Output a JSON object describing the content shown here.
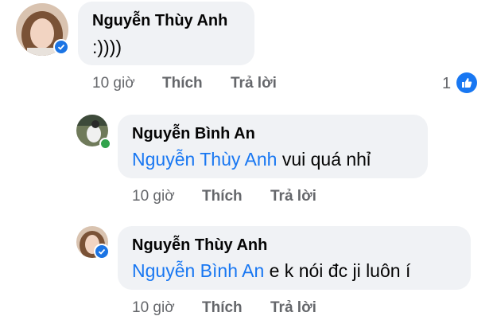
{
  "comments": [
    {
      "author": "Nguyễn Thùy Anh",
      "mention": "",
      "text": ":))))",
      "time": "10 giờ",
      "like_label": "Thích",
      "reply_label": "Trả lời",
      "reaction_count": "1",
      "reaction_icon": "thumbs-up-icon",
      "verified": true
    },
    {
      "author": "Nguyễn Bình An",
      "mention": "Nguyễn Thùy Anh",
      "text": " vui quá nhỉ",
      "time": "10 giờ",
      "like_label": "Thích",
      "reply_label": "Trả lời",
      "online": true
    },
    {
      "author": "Nguyễn Thùy Anh",
      "mention": "Nguyễn Bình An",
      "text": " e k nói đc ji luôn í",
      "time": "10 giờ",
      "like_label": "Thích",
      "reply_label": "Trả lời",
      "verified": true
    }
  ],
  "colors": {
    "mention": "#1877f2",
    "bubble": "#f0f2f5",
    "meta": "#65676b",
    "online": "#31a24c"
  }
}
